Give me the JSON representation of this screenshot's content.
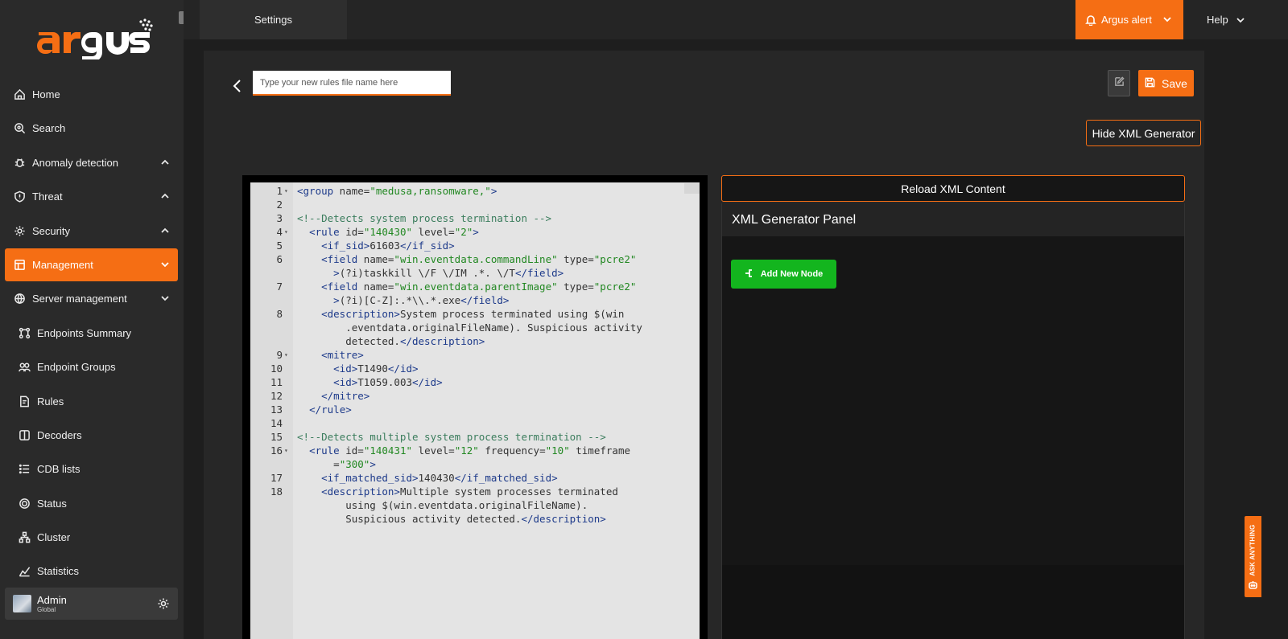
{
  "brand": {
    "name": "argus",
    "accent": "#f56e14"
  },
  "topbar": {
    "tab_label": "Settings",
    "alert_label": "Argus alert",
    "help_label": "Help"
  },
  "sidebar": {
    "items": [
      {
        "label": "Home",
        "icon": "home-icon"
      },
      {
        "label": "Search",
        "icon": "search-icon"
      },
      {
        "label": "Anomaly detection",
        "icon": "bug-icon",
        "expanded": true
      },
      {
        "label": "Threat",
        "icon": "shield-icon",
        "expanded": true
      },
      {
        "label": "Security",
        "icon": "gear-icon",
        "expanded": true
      },
      {
        "label": "Management",
        "icon": "management-icon",
        "active": true
      },
      {
        "label": "Server management",
        "icon": "globe-icon"
      },
      {
        "label": "Endpoints Summary",
        "icon": "nodes-icon"
      },
      {
        "label": "Endpoint Groups",
        "icon": "group-icon"
      },
      {
        "label": "Rules",
        "icon": "rules-icon"
      },
      {
        "label": "Decoders",
        "icon": "decoder-icon"
      },
      {
        "label": "CDB lists",
        "icon": "list-icon"
      },
      {
        "label": "Status",
        "icon": "status-icon"
      },
      {
        "label": "Cluster",
        "icon": "cluster-icon"
      },
      {
        "label": "Statistics",
        "icon": "statistics-icon"
      }
    ],
    "user": {
      "name": "Admin",
      "role": "Global"
    }
  },
  "toolbar": {
    "filename_placeholder": "Type your new rules file name here",
    "save_label": "Save",
    "hide_xml_label": "Hide XML Generator"
  },
  "generator": {
    "reload_label": "Reload XML Content",
    "title": "XML Generator Panel",
    "add_node_label": "Add New Node"
  },
  "ask_anything": "ASK ANYTHING",
  "editor": {
    "lines": [
      {
        "n": "1",
        "fold": true,
        "html": "<span class='tag'>&lt;group</span> name=<span class='str'>\"medusa,ransomware,\"</span><span class='tag'>&gt;</span>"
      },
      {
        "n": "2",
        "html": ""
      },
      {
        "n": "3",
        "html": "<span class='cmt'>&lt;!--Detects system process termination --&gt;</span>"
      },
      {
        "n": "4",
        "fold": true,
        "html": "  <span class='tag'>&lt;rule</span> id=<span class='str'>\"140430\"</span> level=<span class='str'>\"2\"</span><span class='tag'>&gt;</span>"
      },
      {
        "n": "5",
        "html": "    <span class='tag'>&lt;if_sid&gt;</span>61603<span class='tag'>&lt;/if_sid&gt;</span>"
      },
      {
        "n": "6",
        "html": "    <span class='tag'>&lt;field</span> name=<span class='str'>\"win.eventdata.commandLine\"</span> type=<span class='str'>\"pcre2\"</span>"
      },
      {
        "n": "",
        "html": "      <span class='tag'>&gt;</span>(?i)taskkill \\/F \\/IM .*. \\/T<span class='tag'>&lt;/field&gt;</span>"
      },
      {
        "n": "7",
        "html": "    <span class='tag'>&lt;field</span> name=<span class='str'>\"win.eventdata.parentImage\"</span> type=<span class='str'>\"pcre2\"</span>"
      },
      {
        "n": "",
        "html": "      <span class='tag'>&gt;</span>(?i)[C-Z]:.*\\\\.*.exe<span class='tag'>&lt;/field&gt;</span>"
      },
      {
        "n": "8",
        "html": "    <span class='tag'>&lt;description&gt;</span>System process terminated using $(win"
      },
      {
        "n": "",
        "html": "        .eventdata.originalFileName). Suspicious activity"
      },
      {
        "n": "",
        "html": "        detected.<span class='tag'>&lt;/description&gt;</span>"
      },
      {
        "n": "9",
        "fold": true,
        "html": "    <span class='tag'>&lt;mitre&gt;</span>"
      },
      {
        "n": "10",
        "html": "      <span class='tag'>&lt;id&gt;</span>T1490<span class='tag'>&lt;/id&gt;</span>"
      },
      {
        "n": "11",
        "html": "      <span class='tag'>&lt;id&gt;</span>T1059.003<span class='tag'>&lt;/id&gt;</span>"
      },
      {
        "n": "12",
        "html": "    <span class='tag'>&lt;/mitre&gt;</span>"
      },
      {
        "n": "13",
        "html": "  <span class='tag'>&lt;/rule&gt;</span>"
      },
      {
        "n": "14",
        "html": ""
      },
      {
        "n": "15",
        "html": "<span class='cmt'>&lt;!--Detects multiple system process termination --&gt;</span>"
      },
      {
        "n": "16",
        "fold": true,
        "html": "  <span class='tag'>&lt;rule</span> id=<span class='str'>\"140431\"</span> level=<span class='str'>\"12\"</span> frequency=<span class='str'>\"10\"</span> timeframe"
      },
      {
        "n": "",
        "html": "      =<span class='str'>\"300\"</span><span class='tag'>&gt;</span>"
      },
      {
        "n": "17",
        "html": "    <span class='tag'>&lt;if_matched_sid&gt;</span>140430<span class='tag'>&lt;/if_matched_sid&gt;</span>"
      },
      {
        "n": "18",
        "html": "    <span class='tag'>&lt;description&gt;</span>Multiple system processes terminated"
      },
      {
        "n": "",
        "html": "        using $(win.eventdata.originalFileName)."
      },
      {
        "n": "",
        "html": "        Suspicious activity detected.<span class='tag'>&lt;/description&gt;</span>"
      }
    ]
  }
}
